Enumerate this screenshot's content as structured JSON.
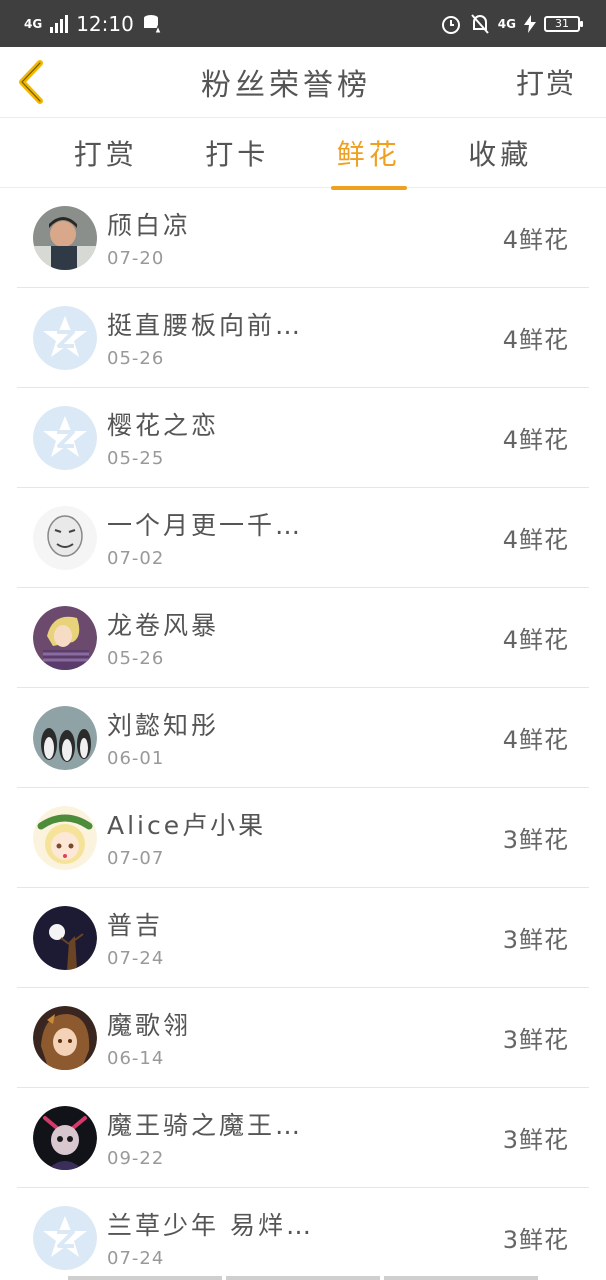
{
  "status_bar": {
    "network_left": "4G",
    "time": "12:10",
    "network_right": "4G",
    "battery": "31"
  },
  "header": {
    "title": "粉丝荣誉榜",
    "action_label": "打赏"
  },
  "tabs": [
    {
      "label": "打赏",
      "active": false
    },
    {
      "label": "打卡",
      "active": false
    },
    {
      "label": "鲜花",
      "active": true
    },
    {
      "label": "收藏",
      "active": false
    }
  ],
  "fans": [
    {
      "name": "颀白凉",
      "date": "07-20",
      "count": "4鲜花",
      "avatar": "photo-boy"
    },
    {
      "name": "挺直腰板向前…",
      "date": "05-26",
      "count": "4鲜花",
      "avatar": "default-z"
    },
    {
      "name": "樱花之恋",
      "date": "05-25",
      "count": "4鲜花",
      "avatar": "default-z"
    },
    {
      "name": "一个月更一千…",
      "date": "07-02",
      "count": "4鲜花",
      "avatar": "meme-face"
    },
    {
      "name": "龙卷风暴",
      "date": "05-26",
      "count": "4鲜花",
      "avatar": "anime-purple"
    },
    {
      "name": "刘懿知彤",
      "date": "06-01",
      "count": "4鲜花",
      "avatar": "penguins"
    },
    {
      "name": "Alice卢小果",
      "date": "07-07",
      "count": "3鲜花",
      "avatar": "anime-wreath"
    },
    {
      "name": "普吉",
      "date": "07-24",
      "count": "3鲜花",
      "avatar": "night-moon"
    },
    {
      "name": "魔歌翎",
      "date": "06-14",
      "count": "3鲜花",
      "avatar": "anime-girl"
    },
    {
      "name": "魔王骑之魔王…",
      "date": "09-22",
      "count": "3鲜花",
      "avatar": "dark-figure"
    },
    {
      "name": "兰草少年 易烊…",
      "date": "07-24",
      "count": "3鲜花",
      "avatar": "default-z"
    }
  ],
  "colors": {
    "accent": "#f0a020",
    "back_arrow": "#f2b600",
    "status_bar_bg": "#3f3f3f",
    "default_avatar": "#dbe8f6"
  }
}
